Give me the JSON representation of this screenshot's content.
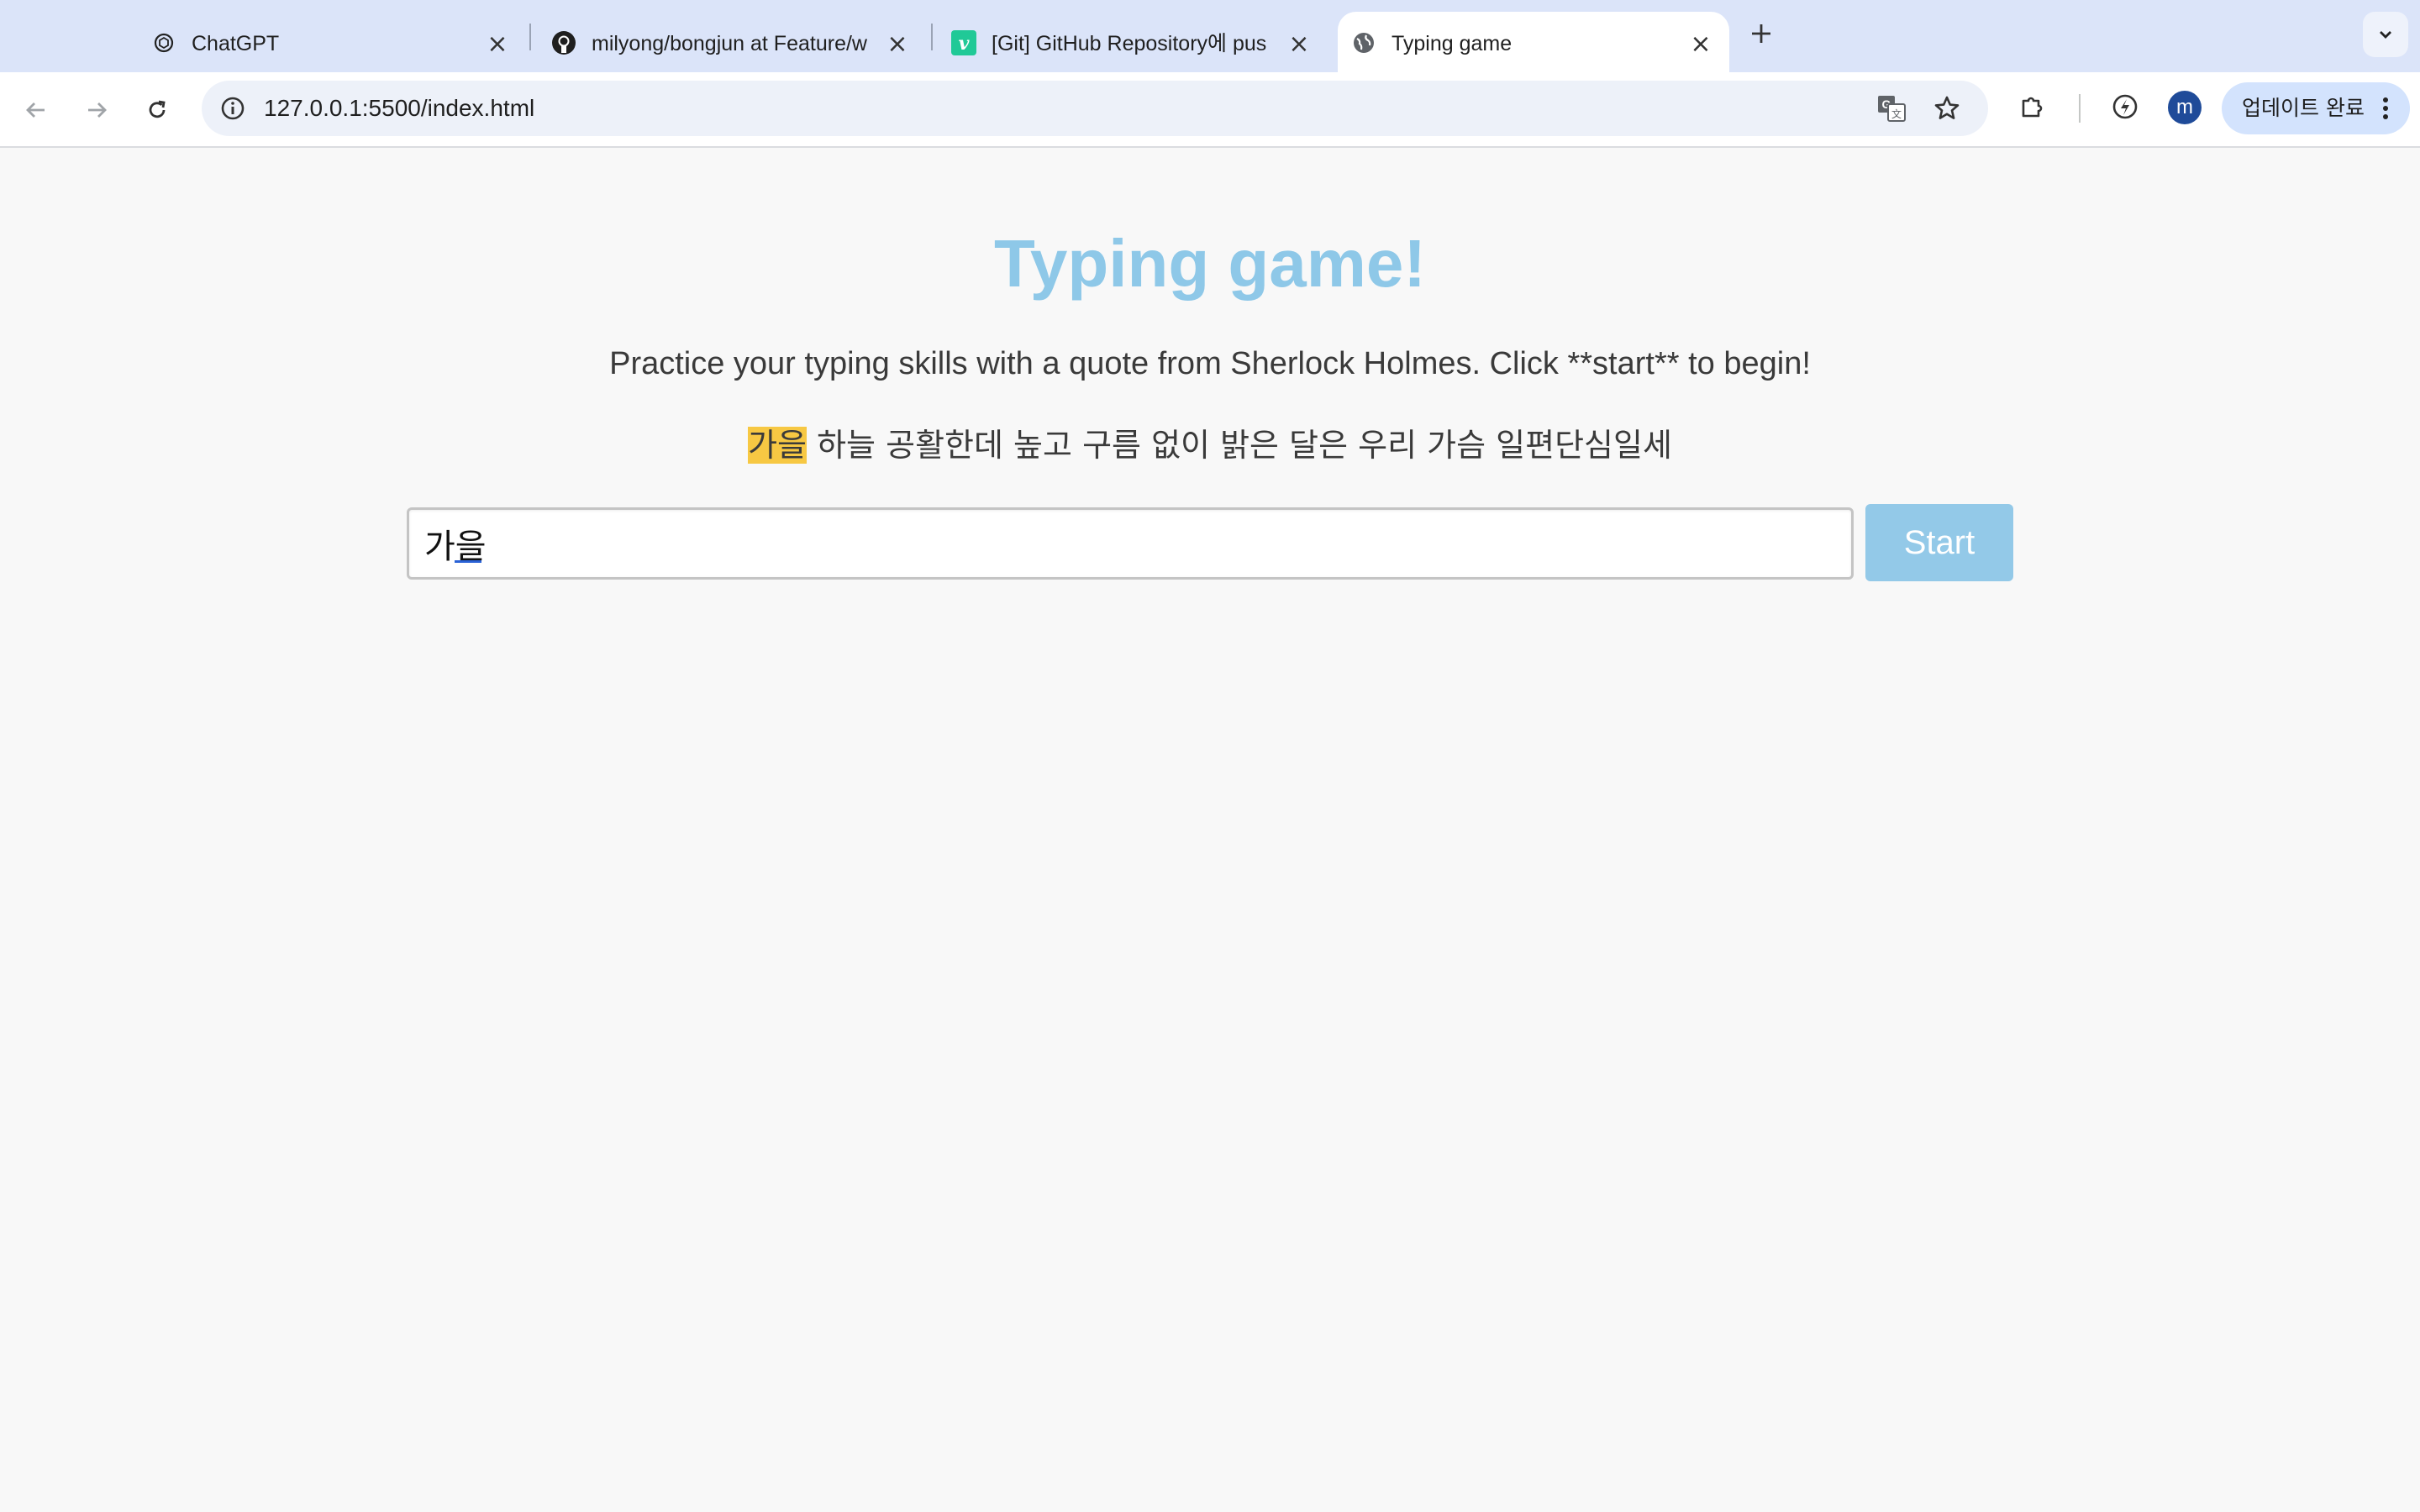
{
  "browser": {
    "tabs": [
      {
        "title": "ChatGPT",
        "icon": "chatgpt-icon",
        "active": false
      },
      {
        "title": "milyong/bongjun at Feature/w",
        "icon": "github-icon",
        "active": false
      },
      {
        "title": "[Git] GitHub Repository에 pus",
        "icon": "velog-icon",
        "active": false
      },
      {
        "title": "Typing game",
        "icon": "globe-icon",
        "active": true
      }
    ],
    "url": "127.0.0.1:5500/index.html",
    "profile_initial": "m",
    "update_button_label": "업데이트 완료"
  },
  "page": {
    "title": "Typing game!",
    "intro": "Practice your typing skills with a quote from Sherlock Holmes. Click **start** to begin!",
    "quote_words": [
      "가을",
      "하늘",
      "공활한데",
      "높고",
      "구름",
      "없이",
      "밝은",
      "달은",
      "우리",
      "가슴",
      "일편단심일세"
    ],
    "highlighted_word_index": 0,
    "typed_value": "가을",
    "start_label": "Start"
  },
  "colors": {
    "title": "#8ec8e8",
    "button": "#93c9e8",
    "highlight": "#f7c843",
    "background": "#f8f8f8"
  }
}
